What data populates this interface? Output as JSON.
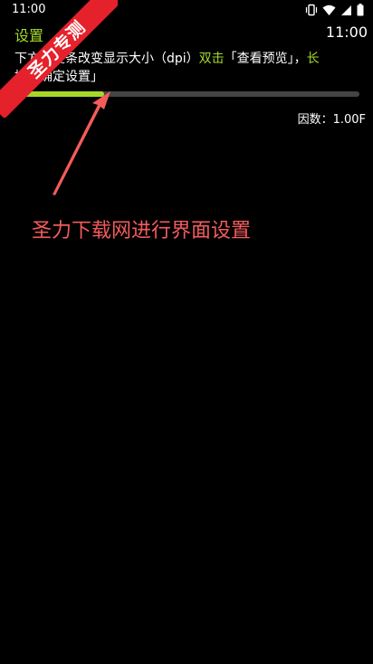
{
  "status_bar": {
    "time": "11:00",
    "icons": [
      "vibrate-icon",
      "wifi-icon",
      "signal-icon",
      "battery-icon"
    ]
  },
  "header": {
    "title": "设置",
    "clock": "11:00"
  },
  "instruction": {
    "part1": "下方进度条改变显示大小（dpi）",
    "part2": "双击",
    "part3": "「查看预览」，",
    "part4": "长",
    "part5": "按「确定设置」"
  },
  "slider": {
    "value_fraction": 0.26
  },
  "factor_label": "因数：1.00F",
  "annotation": {
    "caption": "圣力下载网进行界面设置"
  },
  "watermark": {
    "text": "圣力专测"
  },
  "colors": {
    "background": "#000000",
    "accent": "#a6d82a",
    "annotation": "#f35b5b",
    "ribbon": "#e5212b"
  }
}
